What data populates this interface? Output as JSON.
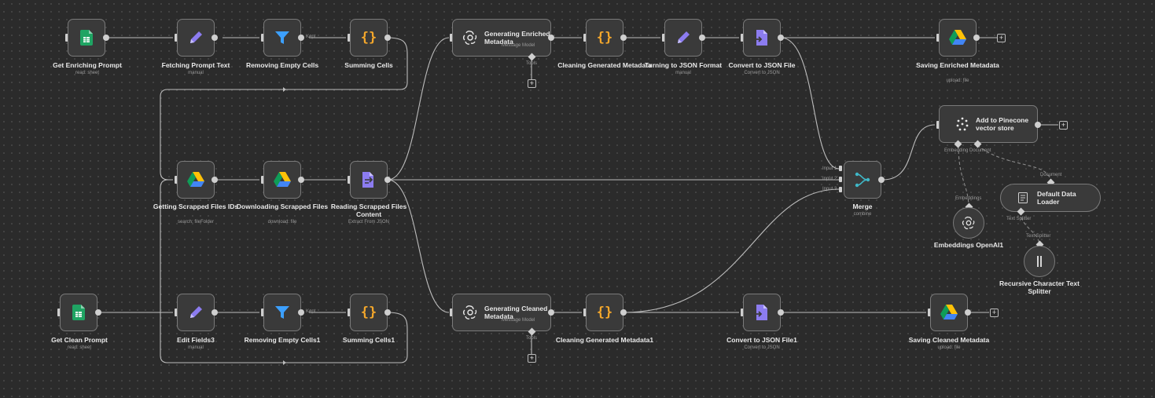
{
  "colors": {
    "canvas": "#2b2b2b",
    "node_bg": "#3a3a3a",
    "sheets_green": "#1fa463",
    "purple": "#8c7cf0",
    "filter_blue": "#3ca0ff",
    "brace_orange": "#f4a72b",
    "merge_teal": "#3fb8c8"
  },
  "nodes": {
    "get_enriching_prompt": {
      "icon": "google-sheets-icon",
      "title": "Get Enriching Prompt",
      "sub": "read: sheet"
    },
    "fetching_prompt_text": {
      "icon": "pencil-icon",
      "title": "Fetching Prompt Text",
      "sub": "manual"
    },
    "removing_empty_cells": {
      "icon": "filter-icon",
      "title": "Removing Empty Cells",
      "sub": ""
    },
    "summing_cells": {
      "icon": "code-braces-icon",
      "title": "Summing Cells",
      "sub": ""
    },
    "generating_enriched": {
      "icon": "openai-icon",
      "title": "Generating Enriched Metadata",
      "sub": "Message Model"
    },
    "cleaning_generated": {
      "icon": "code-braces-icon",
      "title": "Cleaning Generated Metadata",
      "sub": ""
    },
    "turning_json": {
      "icon": "pencil-icon",
      "title": "Turning to JSON Format",
      "sub": "manual"
    },
    "convert_json": {
      "icon": "convert-file-icon",
      "title": "Convert to JSON File",
      "sub": "Convert to JSON"
    },
    "saving_enriched": {
      "icon": "google-drive-icon",
      "title": "Saving Enriched Metadata",
      "sub": "upload: file"
    },
    "pinecone": {
      "icon": "pinecone-icon",
      "title": "Add to Pinecone vector store",
      "sub": ""
    },
    "getting_scrapped": {
      "icon": "google-drive-icon",
      "title": "Getting Scrapped Files IDs",
      "sub": "search: fileFolder"
    },
    "downloading_scrapped": {
      "icon": "google-drive-icon",
      "title": "Downloading Scrapped Files",
      "sub": "download: file"
    },
    "reading_scrapped": {
      "icon": "extract-file-icon",
      "title": "Reading Scrapped Files Content",
      "sub": "Extract From JSON"
    },
    "merge": {
      "icon": "merge-icon",
      "title": "Merge",
      "sub": "combine"
    },
    "default_loader": {
      "icon": "document-icon",
      "title": "Default Data Loader",
      "sub": ""
    },
    "embeddings": {
      "icon": "openai-icon",
      "title": "Embeddings OpenAI1",
      "sub": ""
    },
    "splitter": {
      "icon": "splitter-icon",
      "title": "Recursive Character Text Splitter",
      "sub": ""
    },
    "get_clean_prompt": {
      "icon": "google-sheets-icon",
      "title": "Get Clean Prompt",
      "sub": "read: sheet"
    },
    "edit_fields3": {
      "icon": "pencil-icon",
      "title": "Edit Fields3",
      "sub": "manual"
    },
    "removing_empty_cells1": {
      "icon": "filter-icon",
      "title": "Removing Empty Cells1",
      "sub": ""
    },
    "summing_cells1": {
      "icon": "code-braces-icon",
      "title": "Summing Cells1",
      "sub": ""
    },
    "generating_cleaned": {
      "icon": "openai-icon",
      "title": "Generating Cleaned Metadata",
      "sub": "Message Model"
    },
    "cleaning_generated1": {
      "icon": "code-braces-icon",
      "title": "Cleaning Generated Metadata1",
      "sub": ""
    },
    "convert_json1": {
      "icon": "convert-file-icon",
      "title": "Convert to JSON File1",
      "sub": "Convert to JSON"
    },
    "saving_cleaned": {
      "icon": "google-drive-icon",
      "title": "Saving Cleaned Metadata",
      "sub": "upload: file"
    }
  },
  "labels": {
    "kept": "Kept",
    "kept1": "Kept",
    "tools": "Tools",
    "tools1": "Tools",
    "input1": "Input 1",
    "input2": "Input 2",
    "input3": "Input 3",
    "embedding_document": "Embedding Document",
    "document": "Document",
    "embeddings": "Embeddings",
    "text_splitter": "Text Splitter",
    "text_splitter2": "Text Splitter",
    "plus": "+"
  }
}
